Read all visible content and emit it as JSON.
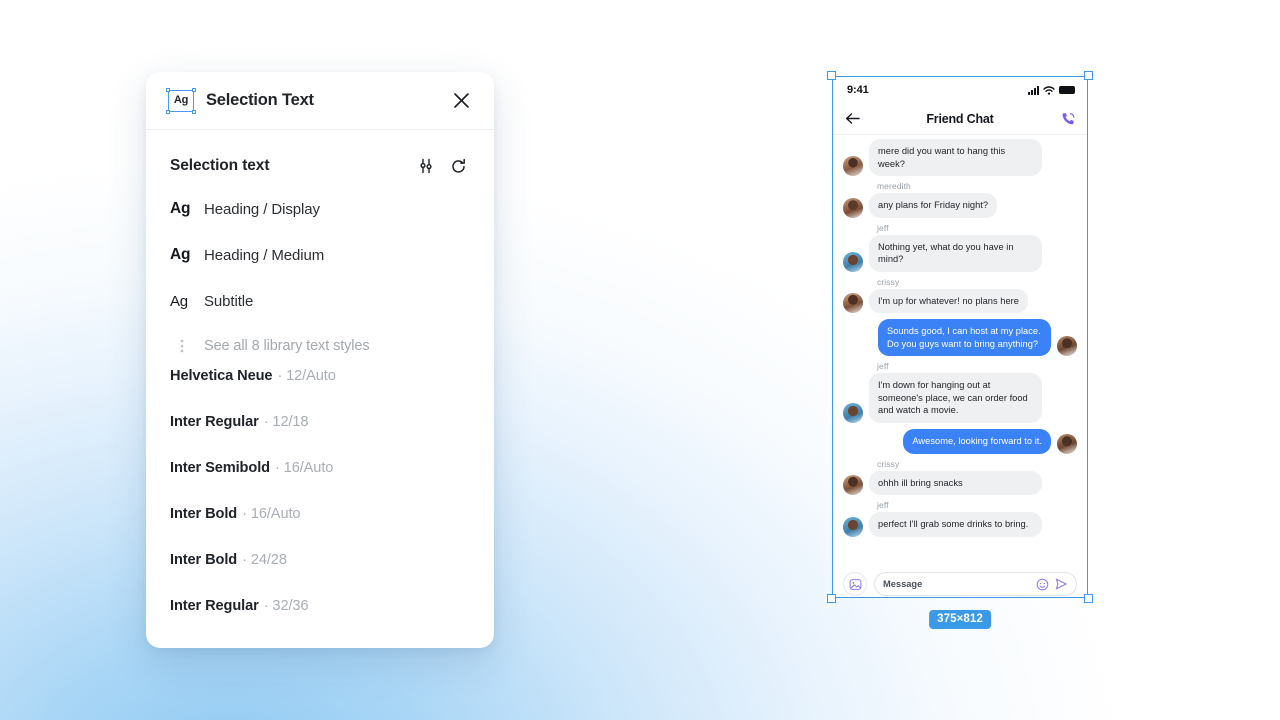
{
  "panel": {
    "badge_text": "Ag",
    "title": "Selection Text",
    "close_icon": "close-icon",
    "section": {
      "title": "Selection text",
      "settings_icon": "sliders-icon",
      "reset_icon": "refresh-icon"
    },
    "text_styles": [
      {
        "sample": "Ag",
        "weight": "bold",
        "label": "Heading / Display"
      },
      {
        "sample": "Ag",
        "weight": "bold",
        "label": "Heading / Medium"
      },
      {
        "sample": "Ag",
        "weight": "regular",
        "label": "Subtitle"
      }
    ],
    "see_all": {
      "icon": "kebab-menu-icon",
      "label": "See all 8 library text styles"
    },
    "fonts": [
      {
        "name": "Helvetica Neue",
        "meta": "· 12/Auto"
      },
      {
        "name": "Inter Regular",
        "meta": "· 12/18"
      },
      {
        "name": "Inter Semibold",
        "meta": "· 16/Auto"
      },
      {
        "name": "Inter Bold",
        "meta": "· 16/Auto"
      },
      {
        "name": "Inter Bold",
        "meta": "· 24/28"
      },
      {
        "name": "Inter Regular",
        "meta": "· 32/36"
      }
    ]
  },
  "canvas": {
    "selection_color": "#3a9ae8",
    "dimension_badge": "375×812"
  },
  "phone": {
    "status_bar": {
      "time": "9:41",
      "signal_icon": "cellular-signal-icon",
      "wifi_icon": "wifi-icon",
      "battery_icon": "battery-icon"
    },
    "nav": {
      "back_icon": "back-arrow-icon",
      "title": "Friend Chat",
      "call_icon": "phone-call-icon"
    },
    "messages": [
      {
        "sender": null,
        "side": "in",
        "text": "mere did you want to hang this week?",
        "avatar": "meredith"
      },
      {
        "sender": "meredith",
        "side": "in",
        "text": "any plans for Friday night?",
        "avatar": "meredith"
      },
      {
        "sender": "jeff",
        "side": "in",
        "text": "Nothing yet, what do you have in mind?",
        "avatar": "jeff",
        "wide": true
      },
      {
        "sender": "crissy",
        "side": "in",
        "text": "I'm up for whatever! no plans here",
        "avatar": "crissy"
      },
      {
        "sender": null,
        "side": "out",
        "text": "Sounds good, I can host at my place. Do you guys want to bring anything?",
        "avatar": "me",
        "wide": true
      },
      {
        "sender": "jeff",
        "side": "in",
        "text": "I'm down for hanging out at someone's place, we can order food and watch a movie.",
        "avatar": "jeff",
        "wide": true
      },
      {
        "sender": null,
        "side": "out",
        "text": "Awesome, looking forward to it.",
        "avatar": "me"
      },
      {
        "sender": "crissy",
        "side": "in",
        "text": "ohhh ill bring snacks",
        "avatar": "crissy",
        "wide": true
      },
      {
        "sender": "jeff",
        "side": "in",
        "text": "perfect I'll grab some drinks to bring.",
        "avatar": "jeff",
        "wide": true
      }
    ],
    "composer": {
      "image_icon": "image-attachment-icon",
      "placeholder": "Message",
      "emoji_icon": "emoji-smiley-icon",
      "send_icon": "send-icon"
    },
    "bubble_colors": {
      "incoming": "#eef0f2",
      "outgoing": "#3b82f6"
    }
  }
}
